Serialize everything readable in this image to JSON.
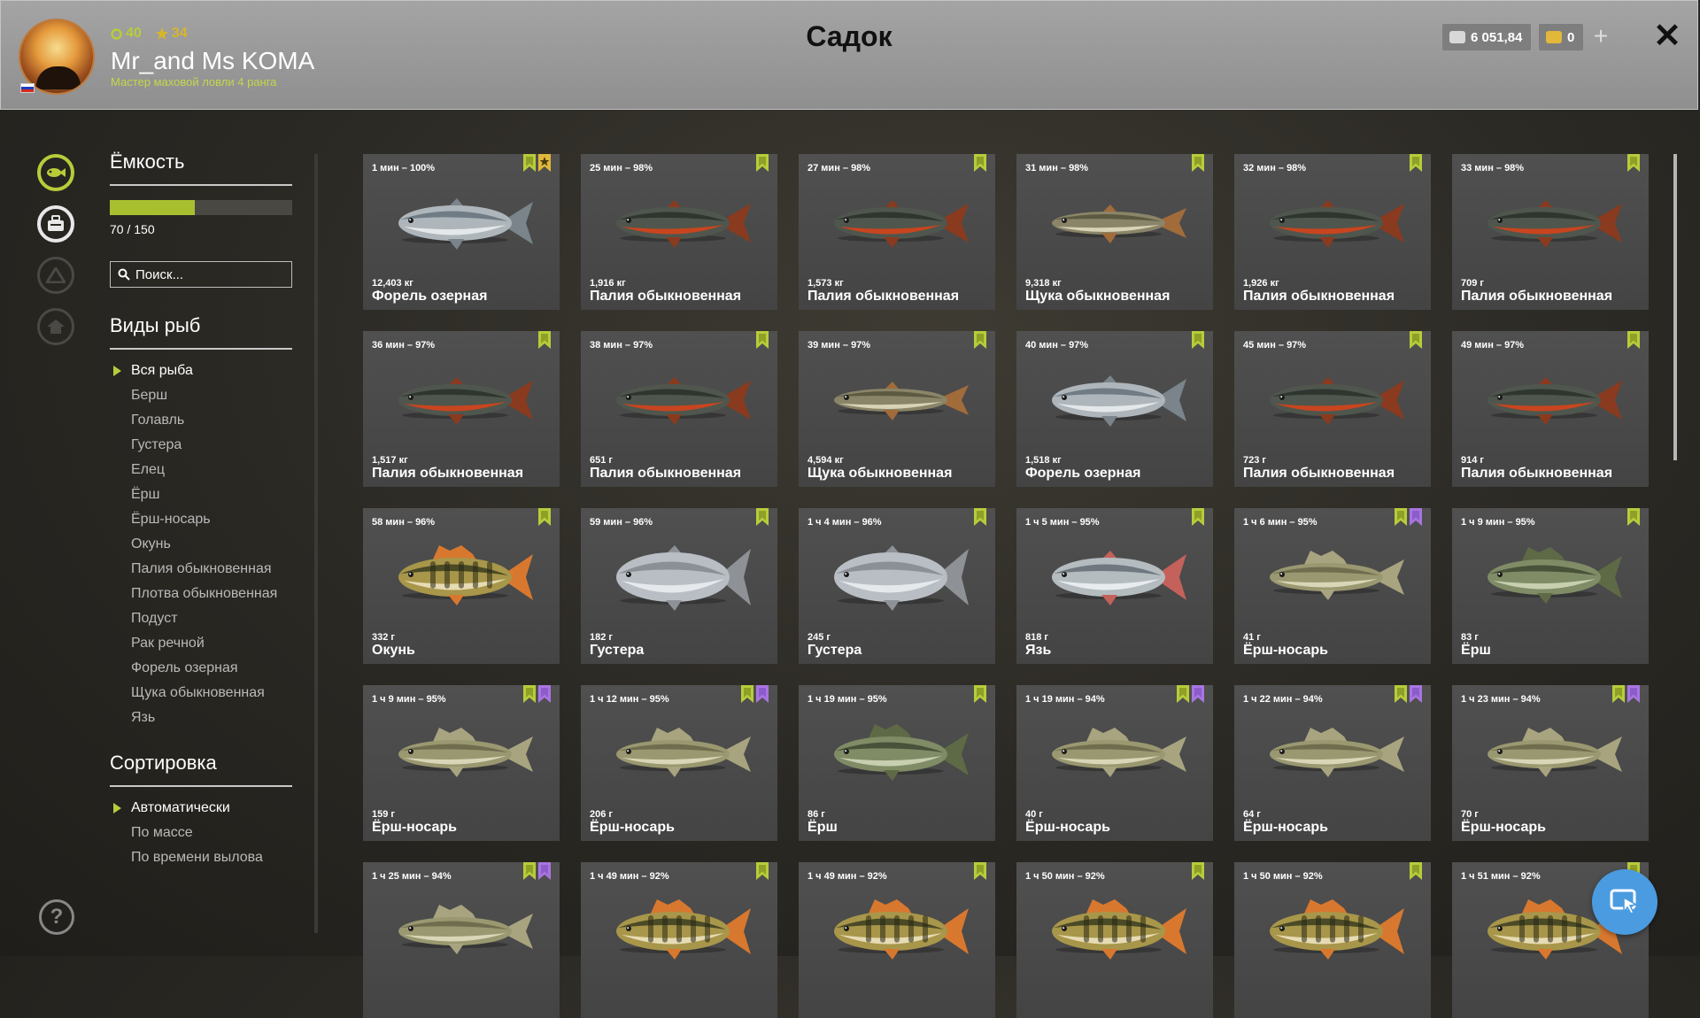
{
  "header": {
    "title": "Садок",
    "username": "Mr_and Ms KOMA",
    "rank": "Мастер маховой ловли 4 ранга",
    "level": "40",
    "stars": "34",
    "silver": "6 051,84",
    "gold": "0"
  },
  "sidebar": {
    "capacity_title": "Ёмкость",
    "capacity_text": "70 / 150",
    "capacity_fraction": 0.4667,
    "search_placeholder": "Поиск...",
    "species_title": "Виды рыб",
    "species": [
      "Вся рыба",
      "Берш",
      "Голавль",
      "Густера",
      "Елец",
      "Ёрш",
      "Ёрш-носарь",
      "Окунь",
      "Палия обыкновенная",
      "Плотва обыкновенная",
      "Подуст",
      "Рак речной",
      "Форель озерная",
      "Щука обыкновенная",
      "Язь"
    ],
    "sort_title": "Сортировка",
    "sort_options": [
      "Автоматически",
      "По массе",
      "По времени вылова"
    ]
  },
  "colors": {
    "accent": "#b8cc3a",
    "bookmark_green": "#b8cc3a",
    "bookmark_purple": "#a875e0",
    "star_gold": "#e2b83a",
    "float_button": "#4b9be0"
  },
  "fish": [
    {
      "time": "1 мин – 100%",
      "weight": "12,403 кг",
      "name": "Форель озерная",
      "kind": "trout",
      "tags": [
        "green",
        "gold-star"
      ]
    },
    {
      "time": "25 мин – 98%",
      "weight": "1,916 кг",
      "name": "Палия обыкновенная",
      "kind": "char",
      "tags": [
        "green"
      ]
    },
    {
      "time": "27 мин – 98%",
      "weight": "1,573 кг",
      "name": "Палия обыкновенная",
      "kind": "char",
      "tags": [
        "green"
      ]
    },
    {
      "time": "31 мин – 98%",
      "weight": "9,318 кг",
      "name": "Щука обыкновенная",
      "kind": "pike",
      "tags": [
        "green"
      ]
    },
    {
      "time": "32 мин – 98%",
      "weight": "1,926 кг",
      "name": "Палия обыкновенная",
      "kind": "char",
      "tags": [
        "green"
      ]
    },
    {
      "time": "33 мин – 98%",
      "weight": "709 г",
      "name": "Палия обыкновенная",
      "kind": "char",
      "tags": [
        "green"
      ]
    },
    {
      "time": "36 мин – 97%",
      "weight": "1,517 кг",
      "name": "Палия обыкновенная",
      "kind": "char",
      "tags": [
        "green"
      ]
    },
    {
      "time": "38 мин – 97%",
      "weight": "651 г",
      "name": "Палия обыкновенная",
      "kind": "char",
      "tags": [
        "green"
      ]
    },
    {
      "time": "39 мин – 97%",
      "weight": "4,594 кг",
      "name": "Щука обыкновенная",
      "kind": "pike",
      "tags": [
        "green"
      ]
    },
    {
      "time": "40 мин – 97%",
      "weight": "1,518 кг",
      "name": "Форель озерная",
      "kind": "trout",
      "tags": [
        "green"
      ]
    },
    {
      "time": "45 мин – 97%",
      "weight": "723 г",
      "name": "Палия обыкновенная",
      "kind": "char",
      "tags": [
        "green"
      ]
    },
    {
      "time": "49 мин – 97%",
      "weight": "914 г",
      "name": "Палия обыкновенная",
      "kind": "char",
      "tags": [
        "green"
      ]
    },
    {
      "time": "58 мин – 96%",
      "weight": "332 г",
      "name": "Окунь",
      "kind": "perch",
      "tags": [
        "green"
      ]
    },
    {
      "time": "59 мин – 96%",
      "weight": "182 г",
      "name": "Густера",
      "kind": "bream",
      "tags": [
        "green"
      ]
    },
    {
      "time": "1 ч 4 мин – 96%",
      "weight": "245 г",
      "name": "Густера",
      "kind": "bream",
      "tags": [
        "green"
      ]
    },
    {
      "time": "1 ч 5 мин – 95%",
      "weight": "818 г",
      "name": "Язь",
      "kind": "ide",
      "tags": [
        "green"
      ]
    },
    {
      "time": "1 ч 6 мин – 95%",
      "weight": "41 г",
      "name": "Ёрш-носарь",
      "kind": "ruffe",
      "tags": [
        "green",
        "purple"
      ]
    },
    {
      "time": "1 ч 9 мин – 95%",
      "weight": "83 г",
      "name": "Ёрш",
      "kind": "ruffe2",
      "tags": [
        "green"
      ]
    },
    {
      "time": "1 ч 9 мин – 95%",
      "weight": "159 г",
      "name": "Ёрш-носарь",
      "kind": "ruffe",
      "tags": [
        "green",
        "purple"
      ]
    },
    {
      "time": "1 ч 12 мин – 95%",
      "weight": "206 г",
      "name": "Ёрш-носарь",
      "kind": "ruffe",
      "tags": [
        "green",
        "purple"
      ]
    },
    {
      "time": "1 ч 19 мин – 95%",
      "weight": "86 г",
      "name": "Ёрш",
      "kind": "ruffe2",
      "tags": [
        "green"
      ]
    },
    {
      "time": "1 ч 19 мин – 94%",
      "weight": "40 г",
      "name": "Ёрш-носарь",
      "kind": "ruffe",
      "tags": [
        "green",
        "purple"
      ]
    },
    {
      "time": "1 ч 22 мин – 94%",
      "weight": "64 г",
      "name": "Ёрш-носарь",
      "kind": "ruffe",
      "tags": [
        "green",
        "purple"
      ]
    },
    {
      "time": "1 ч 23 мин – 94%",
      "weight": "70 г",
      "name": "Ёрш-носарь",
      "kind": "ruffe",
      "tags": [
        "green",
        "purple"
      ]
    },
    {
      "time": "1 ч 25 мин – 94%",
      "weight": "",
      "name": "",
      "kind": "ruffe",
      "tags": [
        "green",
        "purple"
      ]
    },
    {
      "time": "1 ч 49 мин – 92%",
      "weight": "",
      "name": "",
      "kind": "perch",
      "tags": [
        "green"
      ]
    },
    {
      "time": "1 ч 49 мин – 92%",
      "weight": "",
      "name": "",
      "kind": "perch",
      "tags": [
        "green"
      ]
    },
    {
      "time": "1 ч 50 мин – 92%",
      "weight": "",
      "name": "",
      "kind": "perch",
      "tags": [
        "green"
      ]
    },
    {
      "time": "1 ч 50 мин – 92%",
      "weight": "",
      "name": "",
      "kind": "perch",
      "tags": [
        "green"
      ]
    },
    {
      "time": "1 ч 51 мин – 92%",
      "weight": "",
      "name": "",
      "kind": "perch",
      "tags": [
        "green"
      ]
    }
  ]
}
